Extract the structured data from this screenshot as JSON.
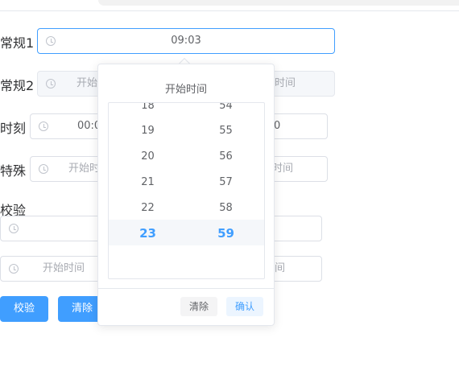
{
  "form": {
    "rows": [
      {
        "label": "常规1",
        "start": "09:03"
      },
      {
        "label": "常规2",
        "start_placeholder": "开始",
        "end_placeholder": "时间"
      },
      {
        "label": "时刻",
        "start": "00:0",
        "end": "0"
      },
      {
        "label": "特殊",
        "start_placeholder": "开始时",
        "end_placeholder": "时间"
      },
      {
        "label": "校验",
        "row2_start_placeholder": "开始时间",
        "row2_end_placeholder": "间"
      }
    ],
    "buttons": {
      "validate": "校验",
      "clear": "清除"
    }
  },
  "picker": {
    "title": "开始时间",
    "hours": [
      "18",
      "19",
      "20",
      "21",
      "22",
      "23"
    ],
    "minutes": [
      "54",
      "55",
      "56",
      "57",
      "58",
      "59"
    ],
    "selected_hour": "23",
    "selected_minute": "59",
    "clear_label": "清除",
    "confirm_label": "确认"
  },
  "colors": {
    "accent": "#409eff",
    "border": "#dcdfe6",
    "text": "#606266",
    "placeholder": "#a8abb2"
  }
}
